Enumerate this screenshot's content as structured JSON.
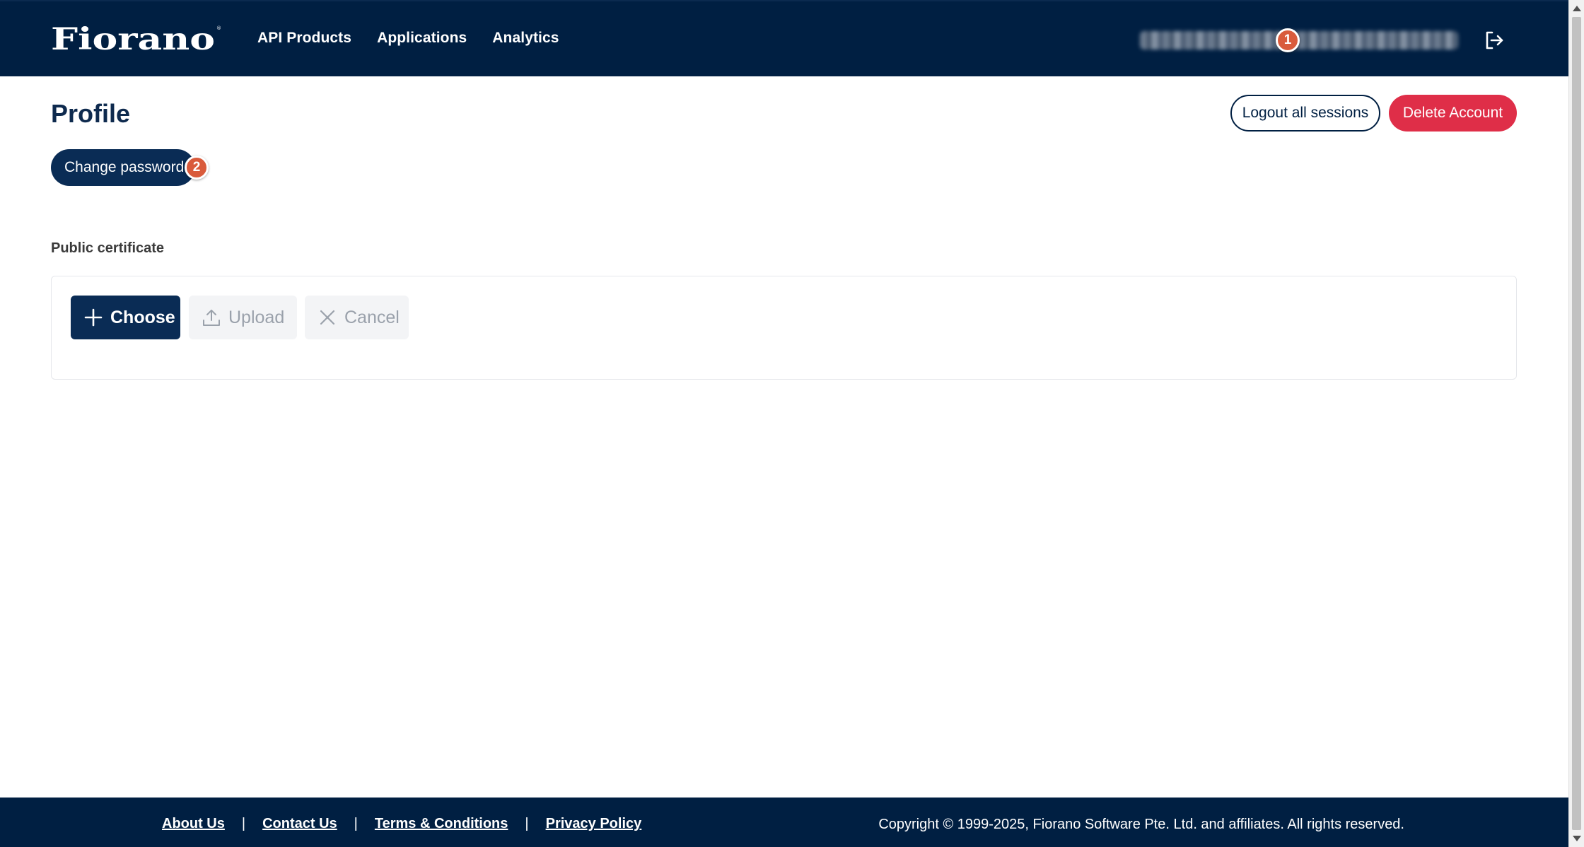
{
  "header": {
    "logo_text": "Fiorano",
    "nav": [
      {
        "label": "API Products"
      },
      {
        "label": "Applications"
      },
      {
        "label": "Analytics"
      }
    ],
    "user_email_redacted": true,
    "logout_icon": "logout-icon"
  },
  "annotations": {
    "badge_1": "1",
    "badge_2": "2"
  },
  "main": {
    "title": "Profile",
    "logout_all_label": "Logout all sessions",
    "delete_account_label": "Delete Account",
    "change_password_label": "Change password",
    "certificate": {
      "section_label": "Public certificate",
      "choose_label": "Choose",
      "upload_label": "Upload",
      "cancel_label": "Cancel"
    }
  },
  "footer": {
    "links": [
      {
        "label": "About Us"
      },
      {
        "label": "Contact Us"
      },
      {
        "label": "Terms & Conditions"
      },
      {
        "label": "Privacy Policy"
      }
    ],
    "separator": "|",
    "copyright": "Copyright © 1999-2025, Fiorano Software Pte. Ltd. and affiliates. All rights reserved."
  },
  "colors": {
    "brand_navy": "#001f42",
    "primary_button": "#0a2c55",
    "danger": "#df2e48",
    "badge": "#d95b3c"
  }
}
